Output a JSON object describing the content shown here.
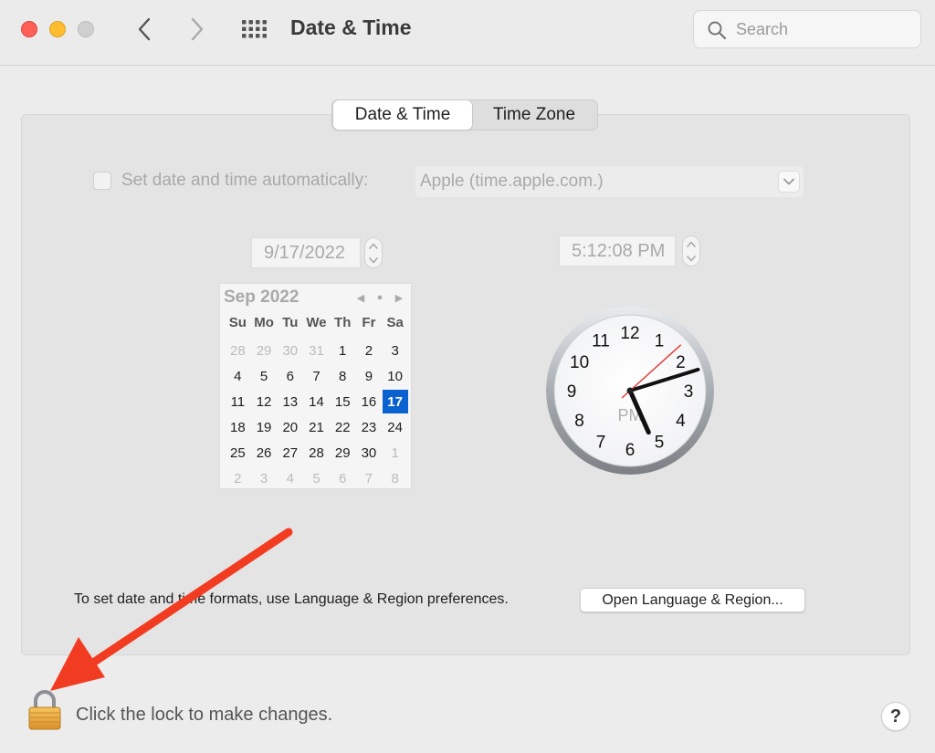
{
  "window": {
    "title": "Date & Time",
    "search_placeholder": "Search"
  },
  "icons": {
    "back": "chevron-left-icon",
    "forward": "chevron-right-icon",
    "show_all": "grid-icon",
    "search": "search-icon",
    "lock": "lock-icon"
  },
  "tabs": {
    "date_time": "Date & Time",
    "time_zone": "Time Zone",
    "selected": "Date & Time"
  },
  "auto": {
    "label": "Set date and time automatically:",
    "checked": false,
    "server": "Apple (time.apple.com.)"
  },
  "date": {
    "value": "9/17/2022"
  },
  "time": {
    "value": "5:12:08 PM"
  },
  "calendar": {
    "month": "Sep 2022",
    "prev": "◀",
    "today": "●",
    "next": "▶",
    "weekdays": [
      "Su",
      "Mo",
      "Tu",
      "We",
      "Th",
      "Fr",
      "Sa"
    ],
    "days": [
      {
        "d": "28",
        "m": true
      },
      {
        "d": "29",
        "m": true
      },
      {
        "d": "30",
        "m": true
      },
      {
        "d": "31",
        "m": true
      },
      {
        "d": "1"
      },
      {
        "d": "2"
      },
      {
        "d": "3"
      },
      {
        "d": "4"
      },
      {
        "d": "5"
      },
      {
        "d": "6"
      },
      {
        "d": "7"
      },
      {
        "d": "8"
      },
      {
        "d": "9"
      },
      {
        "d": "10"
      },
      {
        "d": "11"
      },
      {
        "d": "12"
      },
      {
        "d": "13"
      },
      {
        "d": "14"
      },
      {
        "d": "15"
      },
      {
        "d": "16"
      },
      {
        "d": "17",
        "sel": true
      },
      {
        "d": "18"
      },
      {
        "d": "19"
      },
      {
        "d": "20"
      },
      {
        "d": "21"
      },
      {
        "d": "22"
      },
      {
        "d": "23"
      },
      {
        "d": "24"
      },
      {
        "d": "25"
      },
      {
        "d": "26"
      },
      {
        "d": "27"
      },
      {
        "d": "28"
      },
      {
        "d": "29"
      },
      {
        "d": "30"
      },
      {
        "d": "1",
        "m": true
      },
      {
        "d": "2",
        "m": true
      },
      {
        "d": "3",
        "m": true
      },
      {
        "d": "4",
        "m": true
      },
      {
        "d": "5",
        "m": true
      },
      {
        "d": "6",
        "m": true
      },
      {
        "d": "7",
        "m": true
      },
      {
        "d": "8",
        "m": true
      }
    ],
    "selected_color": "#0a62d0"
  },
  "clock": {
    "numbers": [
      "12",
      "1",
      "2",
      "3",
      "4",
      "5",
      "6",
      "7",
      "8",
      "9",
      "10",
      "11"
    ],
    "ampm": "PM",
    "hours": 5,
    "minutes": 12,
    "seconds": 8,
    "second_hand_color": "#e0342c"
  },
  "formats": {
    "text": "To set date and time formats, use Language & Region preferences.",
    "button": "Open Language & Region..."
  },
  "lock": {
    "text": "Click the lock to make changes."
  },
  "help": {
    "label": "?"
  },
  "annotation": {
    "arrow_color": "#f23c22"
  }
}
